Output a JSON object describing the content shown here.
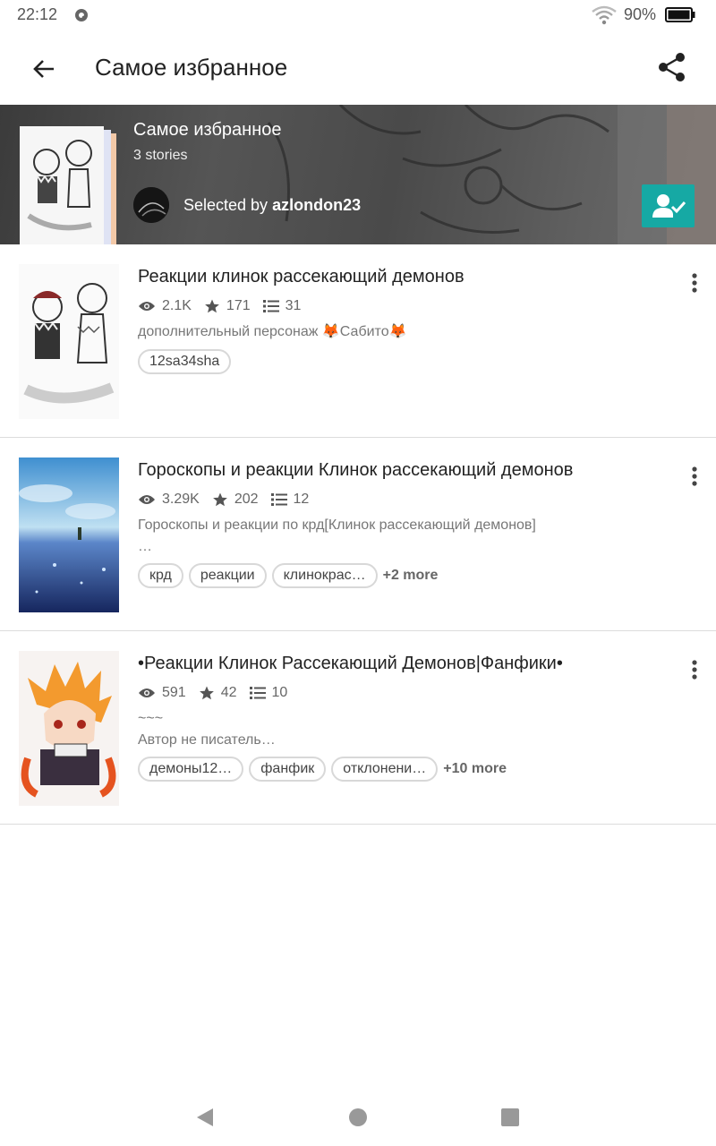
{
  "status_bar": {
    "time": "22:12",
    "battery": "90%"
  },
  "toolbar": {
    "title": "Самое избранное"
  },
  "header": {
    "title": "Самое избранное",
    "count": "3 stories",
    "curator_prefix": "Selected by",
    "curator_name": "azlondon23",
    "accent": "#16a9a4"
  },
  "stories": [
    {
      "title": "Реакции клинок рассекающий демонов",
      "reads": "2.1K",
      "votes": "171",
      "parts": "31",
      "description_lines": [
        "дополнительный персонаж 🦊Сабито🦊"
      ],
      "tags": [
        "12sa34sha"
      ],
      "more": ""
    },
    {
      "title": "Гороскопы и реакции Клинок рассекающий демонов",
      "reads": "3.29K",
      "votes": "202",
      "parts": "12",
      "description_lines": [
        "Гороскопы и реакции по крд[Клинок рассекающий демонов]",
        "…"
      ],
      "tags": [
        "крд",
        "реакции",
        "клинокрас…"
      ],
      "more": "+2 more"
    },
    {
      "title": "•Реакции Клинок Рассекающий Демонов|Фанфики•",
      "reads": "591",
      "votes": "42",
      "parts": "10",
      "description_lines": [
        "~~~",
        "Автор не писатель…"
      ],
      "tags": [
        "демоны12…",
        "фанфик",
        "отклонени…"
      ],
      "more": "+10 more"
    }
  ],
  "icons": {
    "back": "arrow-left-icon",
    "share": "share-icon",
    "follow": "follow-user-check-icon",
    "reads": "eye-icon",
    "votes": "star-icon",
    "parts": "list-icon",
    "overflow": "more-vert-icon"
  }
}
